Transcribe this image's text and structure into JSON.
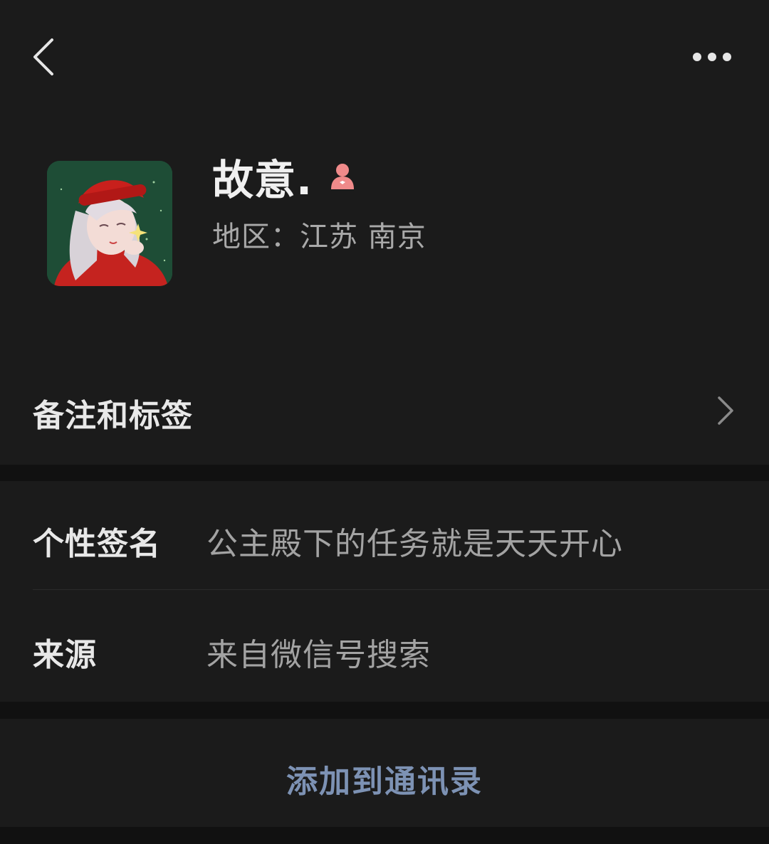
{
  "nav": {
    "back_icon": "chevron-left-icon",
    "more_icon": "ellipsis-icon"
  },
  "profile": {
    "name": "故意.",
    "gender_icon": "female-icon",
    "region": "地区：江苏 南京"
  },
  "remark_row": {
    "label": "备注和标签"
  },
  "info": {
    "signature_label": "个性签名",
    "signature_value": "公主殿下的任务就是天天开心",
    "source_label": "来源",
    "source_value": "来自微信号搜索"
  },
  "action": {
    "add_label": "添加到通讯录"
  },
  "colors": {
    "background": "#111111",
    "card": "#1b1b1b",
    "link_blue": "#7d92b4",
    "female_pink": "#f08a8a"
  }
}
